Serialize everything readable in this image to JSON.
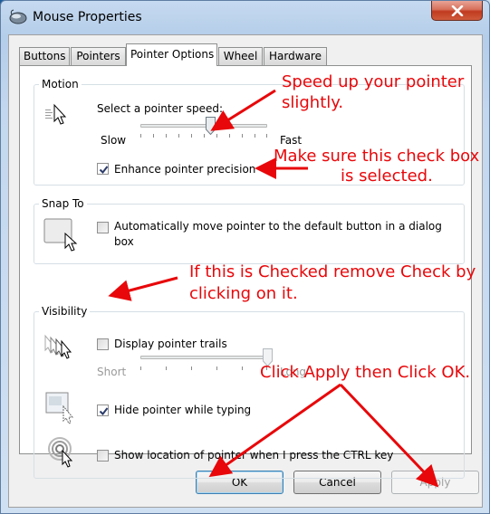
{
  "window": {
    "title": "Mouse Properties",
    "close_icon": "close-icon"
  },
  "tabs": [
    "Buttons",
    "Pointers",
    "Pointer Options",
    "Wheel",
    "Hardware"
  ],
  "active_tab": "Pointer Options",
  "motion": {
    "group_label": "Motion",
    "speed_label": "Select a pointer speed:",
    "slow_label": "Slow",
    "fast_label": "Fast",
    "speed_value": 0.55,
    "enhance_label": "Enhance pointer precision",
    "enhance_checked": true
  },
  "snap_to": {
    "group_label": "Snap To",
    "checkbox_label_line1": "Automatically move pointer to the default button in a dialog",
    "checkbox_label_line2": "box",
    "checked": false
  },
  "visibility": {
    "group_label": "Visibility",
    "trails_label": "Display pointer trails",
    "trails_checked": false,
    "short_label": "Short",
    "long_label": "Long",
    "trail_length_value": 1.0,
    "hide_label": "Hide pointer while typing",
    "hide_checked": true,
    "show_location_label": "Show location of pointer when I press the CTRL key",
    "show_location_checked": false
  },
  "buttons": {
    "ok": "OK",
    "cancel": "Cancel",
    "apply": "Apply"
  },
  "annotations": {
    "speed_line1": "Speed up your pointer",
    "speed_line2": "slightly.",
    "precision_line1": "Make sure this check box",
    "precision_line2": "is selected.",
    "trails_line1": "If this is Checked remove Check by",
    "trails_line2": "clicking on it.",
    "apply_note": "Click Apply then Click OK."
  },
  "colors": {
    "annotation": "#e8070a",
    "close_button": "#c8472b",
    "accent": "#3c7fb1"
  }
}
